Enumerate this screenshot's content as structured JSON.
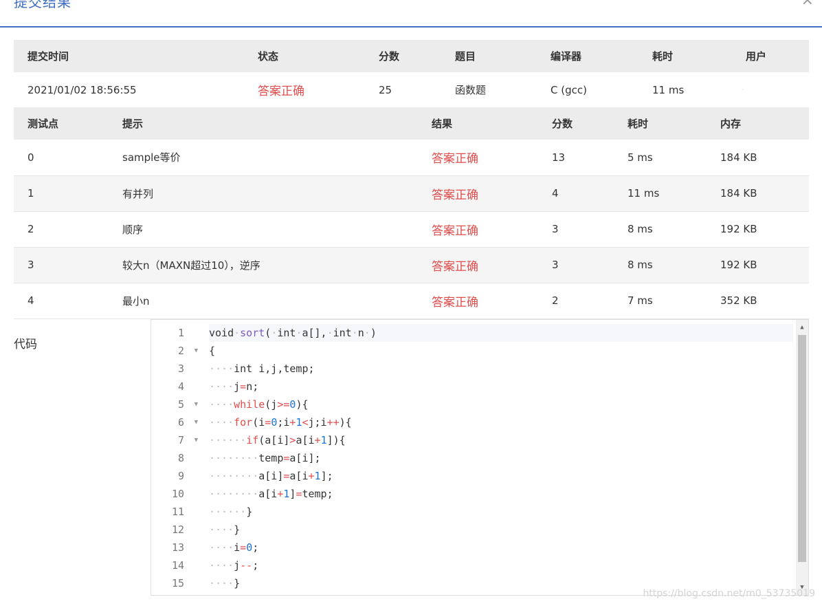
{
  "modal": {
    "title": "提交结果",
    "close": "×"
  },
  "summary": {
    "headers": [
      "提交时间",
      "状态",
      "分数",
      "题目",
      "编译器",
      "耗时",
      "用户"
    ],
    "row": {
      "time": "2021/01/02 18:56:55",
      "status": "答案正确",
      "score": "25",
      "problem": "函数题",
      "compiler": "C (gcc)",
      "elapsed": "11 ms",
      "user": "-"
    }
  },
  "cases": {
    "headers": [
      "测试点",
      "提示",
      "结果",
      "分数",
      "耗时",
      "内存"
    ],
    "rows": [
      {
        "id": "0",
        "hint": "sample等价",
        "result": "答案正确",
        "score": "13",
        "time": "5 ms",
        "memory": "184 KB"
      },
      {
        "id": "1",
        "hint": "有并列",
        "result": "答案正确",
        "score": "4",
        "time": "11 ms",
        "memory": "184 KB"
      },
      {
        "id": "2",
        "hint": "顺序",
        "result": "答案正确",
        "score": "3",
        "time": "8 ms",
        "memory": "192 KB"
      },
      {
        "id": "3",
        "hint": "较大n（MAXN超过10），逆序",
        "result": "答案正确",
        "score": "3",
        "time": "8 ms",
        "memory": "192 KB"
      },
      {
        "id": "4",
        "hint": "最小n",
        "result": "答案正确",
        "score": "2",
        "time": "7 ms",
        "memory": "352 KB"
      }
    ]
  },
  "code_section": {
    "label": "代码",
    "line_numbers": [
      "1",
      "2",
      "3",
      "4",
      "5",
      "6",
      "7",
      "8",
      "9",
      "10",
      "11",
      "12",
      "13",
      "14",
      "15"
    ],
    "lines": [
      "void sort( int a[], int n )",
      "{",
      "    int i,j,temp;",
      "    j=n;",
      "    while(j>=0){",
      "    for(i=0;i+1<j;i++){",
      "      if(a[i]>a[i+1]){",
      "        temp=a[i];",
      "        a[i]=a[i+1];",
      "        a[i+1]=temp;",
      "      }",
      "    }",
      "    i=0;",
      "    j--;",
      "    }"
    ],
    "fold_lines": [
      2,
      5,
      6,
      7
    ]
  },
  "watermark": "https://blog.csdn.net/m0_53735019"
}
